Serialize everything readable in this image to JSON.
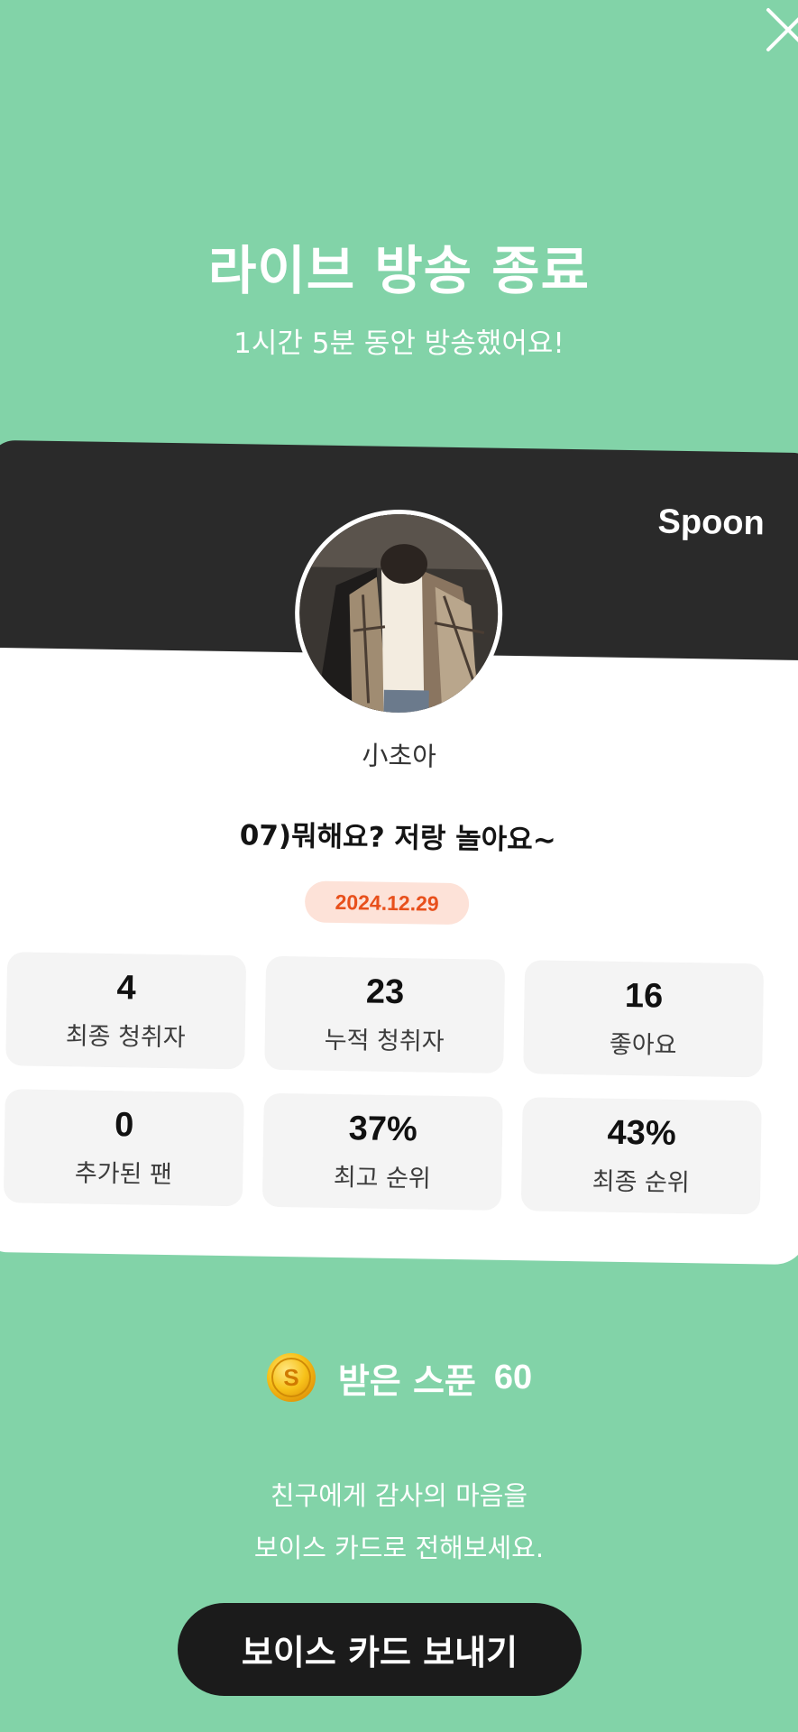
{
  "header": {
    "title": "라이브 방송 종료",
    "subtitle": "1시간 5분 동안 방송했어요!",
    "close_icon": "close-icon"
  },
  "card": {
    "brand": "Spoon",
    "username": "小초아",
    "live_title": "07)뭐해요? 저랑 놀아요~",
    "date": "2024.12.29",
    "colors": {
      "header": "#2a2a2a",
      "date_badge_bg": "#fde2d8",
      "date_badge_text": "#e8501c"
    }
  },
  "stats": [
    {
      "value": "4",
      "label": "최종 청취자"
    },
    {
      "value": "23",
      "label": "누적 청취자"
    },
    {
      "value": "16",
      "label": "좋아요"
    },
    {
      "value": "0",
      "label": "추가된 팬"
    },
    {
      "value": "37%",
      "label": "최고 순위"
    },
    {
      "value": "43%",
      "label": "최종 순위"
    }
  ],
  "spoon": {
    "label": "받은 스푼",
    "count": "60",
    "icon": "spoon-coin-icon"
  },
  "message": {
    "line1": "친구에게 감사의 마음을",
    "line2": "보이스 카드로 전해보세요."
  },
  "cta": {
    "label": "보이스 카드 보내기"
  },
  "theme": {
    "background": "#82d3a8",
    "button": "#1b1b1b"
  }
}
